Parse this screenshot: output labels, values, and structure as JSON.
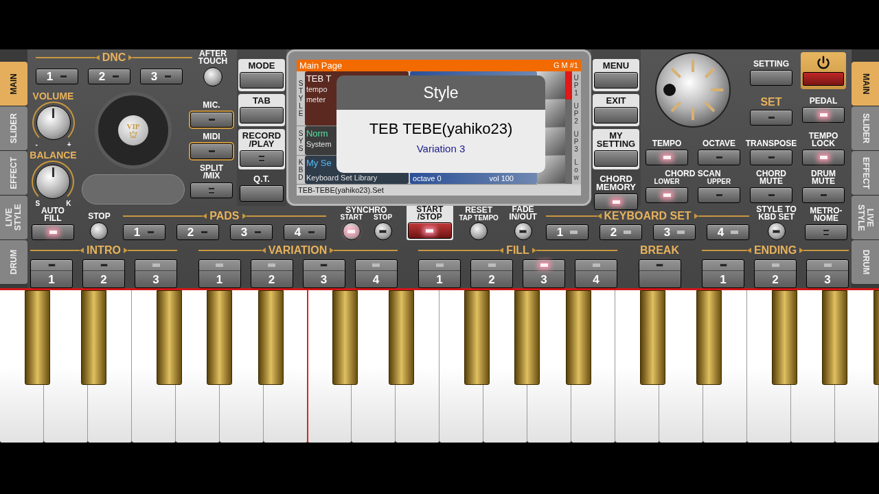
{
  "side_tabs_left": [
    {
      "label": "MAIN",
      "selected": true
    },
    {
      "label": "SLIDER",
      "selected": false
    },
    {
      "label": "EFFECT",
      "selected": false
    },
    {
      "label": "LIVE STYLE",
      "selected": false
    },
    {
      "label": "DRUM",
      "selected": false
    }
  ],
  "side_tabs_right": [
    {
      "label": "MAIN",
      "selected": true
    },
    {
      "label": "SLIDER",
      "selected": false
    },
    {
      "label": "EFFECT",
      "selected": false
    },
    {
      "label": "LIVE STYLE",
      "selected": false
    },
    {
      "label": "DRUM",
      "selected": false
    }
  ],
  "dnc": {
    "title": "DNC",
    "buttons": [
      {
        "label": "1",
        "lit": false
      },
      {
        "label": "2",
        "lit": false
      },
      {
        "label": "3",
        "lit": false
      }
    ]
  },
  "after_touch": {
    "label": "AFTER\nTOUCH"
  },
  "volume": {
    "label": "VOLUME",
    "min": "-",
    "max": "+"
  },
  "balance": {
    "label": "BALANCE",
    "min": "S",
    "max": "K"
  },
  "turntable": {
    "label": "VIP"
  },
  "left_buttons": [
    {
      "label": "MIC.",
      "kind": "single",
      "lit": false,
      "framed": true
    },
    {
      "label": "MIDI",
      "kind": "single",
      "lit": false,
      "framed": true
    },
    {
      "label": "SPLIT\n/MIX",
      "kind": "double",
      "framed": false
    }
  ],
  "mode_buttons": [
    {
      "label": "MODE",
      "kind": "plain",
      "framed": true
    },
    {
      "label": "TAB",
      "kind": "plain",
      "framed": true
    },
    {
      "label": "RECORD\n/PLAY",
      "kind": "double",
      "framed": true
    },
    {
      "label": "Q.T.",
      "kind": "plain",
      "framed": false
    }
  ],
  "screen": {
    "title": "Main Page",
    "bank": "G M #1",
    "sections": [
      {
        "label": "STYLE",
        "kind": "style",
        "title": "TEB T",
        "lines": [
          "tempo",
          "meter"
        ]
      },
      {
        "label": "SYS",
        "kind": "sys",
        "title": "Norm",
        "lines": [
          "System"
        ]
      },
      {
        "label": "KBD",
        "kind": "kbd",
        "title": "My Se",
        "lines": [
          "Keyboard Set Library"
        ],
        "octave": "octave 0",
        "volume": "vol 100"
      }
    ],
    "parts": [
      {
        "label": "UP1",
        "selected": true
      },
      {
        "label": "UP2",
        "selected": false
      },
      {
        "label": "UP3",
        "selected": false
      },
      {
        "label": "Low",
        "selected": false
      }
    ],
    "footer": "TEB-TEBE(yahiko23).Set"
  },
  "popup": {
    "title": "Style",
    "name": "TEB TEBE(yahiko23)",
    "detail": "Variation 3"
  },
  "menu_buttons": [
    {
      "label": "MENU",
      "kind": "plain",
      "framed": true
    },
    {
      "label": "EXIT",
      "kind": "plain",
      "framed": true
    },
    {
      "label": "MY\nSETTING",
      "kind": "plain",
      "framed": true
    },
    {
      "label": "CHORD\nMEMORY",
      "kind": "single",
      "lit": true,
      "framed": false
    }
  ],
  "setting": {
    "label": "SETTING",
    "kind": "plain"
  },
  "set": {
    "label": "SET",
    "lit": false
  },
  "pedal": {
    "label": "PEDAL",
    "lit": true
  },
  "tempo_row": [
    {
      "label": "TEMPO",
      "lit": true
    },
    {
      "label": "OCTAVE",
      "lit": false
    },
    {
      "label": "TRANSPOSE",
      "lit": false
    },
    {
      "label": "TEMPO\nLOCK",
      "lit": true
    }
  ],
  "chord_scan": {
    "title": "CHORD SCAN",
    "buttons": [
      {
        "label": "LOWER",
        "lit": true
      },
      {
        "label": "UPPER",
        "lit": false
      }
    ]
  },
  "mute_buttons": [
    {
      "label": "CHORD\nMUTE",
      "lit": false
    },
    {
      "label": "DRUM\nMUTE",
      "lit": false
    }
  ],
  "auto_fill": {
    "label": "AUTO\nFILL",
    "lit": true
  },
  "stop": {
    "label": "STOP"
  },
  "pads": {
    "title": "PADS",
    "buttons": [
      {
        "label": "1",
        "lit": false
      },
      {
        "label": "2",
        "lit": false
      },
      {
        "label": "3",
        "lit": false
      },
      {
        "label": "4",
        "lit": false
      }
    ]
  },
  "synchro": {
    "title": "SYNCHRO",
    "knobs": [
      {
        "label": "START",
        "lit": true
      },
      {
        "label": "STOP",
        "lit": false
      }
    ]
  },
  "start_stop": {
    "label": "START\n/STOP",
    "lit": true
  },
  "reset": {
    "label": "RESET",
    "sublabel": "TAP TEMPO"
  },
  "fade": {
    "label": "FADE\nIN/OUT",
    "lit": false
  },
  "keyboard_set": {
    "title": "KEYBOARD SET",
    "buttons": [
      {
        "label": "1",
        "lit": false,
        "dim": true
      },
      {
        "label": "2",
        "lit": false,
        "dim": true
      },
      {
        "label": "3",
        "lit": false,
        "dim": true
      },
      {
        "label": "4",
        "lit": false,
        "dim": true
      }
    ]
  },
  "style_to_kbd": {
    "label": "STYLE TO\nKBD SET",
    "lit": false
  },
  "metronome": {
    "label": "METRO-\nNOME",
    "kind": "double"
  },
  "patterns": [
    {
      "title": "INTRO",
      "buttons": [
        {
          "label": "1",
          "lit": false,
          "dim": false
        },
        {
          "label": "2",
          "lit": false,
          "dim": false
        },
        {
          "label": "3",
          "lit": false,
          "dim": true
        }
      ]
    },
    {
      "title": "VARIATION",
      "buttons": [
        {
          "label": "1",
          "lit": false,
          "dim": true
        },
        {
          "label": "2",
          "lit": false,
          "dim": true
        },
        {
          "label": "3",
          "lit": false,
          "dim": false
        },
        {
          "label": "4",
          "lit": false,
          "dim": true
        }
      ]
    },
    {
      "title": "FILL",
      "buttons": [
        {
          "label": "1",
          "lit": false,
          "dim": true
        },
        {
          "label": "2",
          "lit": false,
          "dim": true
        },
        {
          "label": "3",
          "lit": true,
          "dim": false
        },
        {
          "label": "4",
          "lit": false,
          "dim": true
        }
      ]
    },
    {
      "title": "BREAK",
      "buttons": [
        {
          "lit": false,
          "dim": false
        }
      ]
    },
    {
      "title": "ENDING",
      "buttons": [
        {
          "label": "1",
          "lit": false,
          "dim": false
        },
        {
          "label": "2",
          "lit": false,
          "dim": true
        },
        {
          "label": "3",
          "lit": false,
          "dim": true
        }
      ]
    }
  ]
}
